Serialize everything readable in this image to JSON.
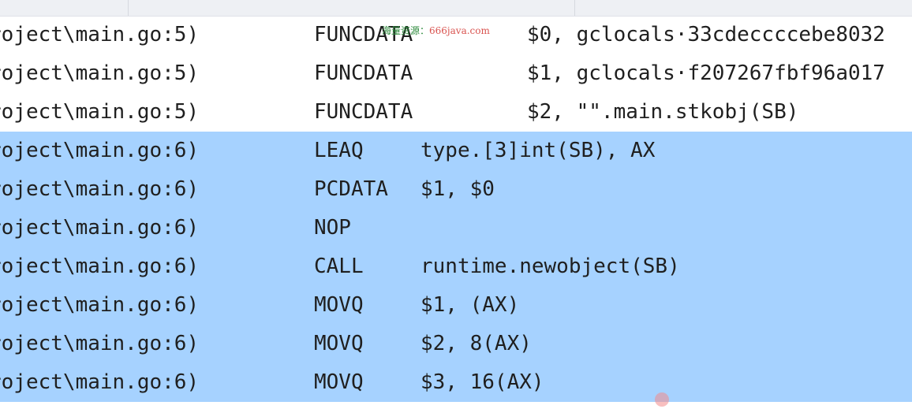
{
  "watermark": {
    "text": "海量资源：",
    "url": "666java.com"
  },
  "rows": [
    {
      "loc": "roject\\main.go:5)",
      "op": "FUNCDATA",
      "args": "$0, gclocals·33cdeccccebe8032",
      "selected": false,
      "argx": 668
    },
    {
      "loc": "roject\\main.go:5)",
      "op": "FUNCDATA",
      "args": "$1, gclocals·f207267fbf96a017",
      "selected": false,
      "argx": 668
    },
    {
      "loc": "roject\\main.go:5)",
      "op": "FUNCDATA",
      "args": "$2, \"\".main.stkobj(SB)",
      "selected": false,
      "argx": 668
    },
    {
      "loc": "roject\\main.go:6)",
      "op": "LEAQ",
      "args": "type.[3]int(SB), AX",
      "selected": true,
      "argx": 533
    },
    {
      "loc": "roject\\main.go:6)",
      "op": "PCDATA",
      "args": "$1, $0",
      "selected": true,
      "argx": 533
    },
    {
      "loc": "roject\\main.go:6)",
      "op": "NOP",
      "args": "",
      "selected": true,
      "argx": 533
    },
    {
      "loc": "roject\\main.go:6)",
      "op": "CALL",
      "args": "runtime.newobject(SB)",
      "selected": true,
      "argx": 533
    },
    {
      "loc": "roject\\main.go:6)",
      "op": "MOVQ",
      "args": "$1, (AX)",
      "selected": true,
      "argx": 533
    },
    {
      "loc": "roject\\main.go:6)",
      "op": "MOVQ",
      "args": "$2, 8(AX)",
      "selected": true,
      "argx": 533
    },
    {
      "loc": "roject\\main.go:6)",
      "op": "MOVQ",
      "args": "$3, 16(AX)",
      "selected": true,
      "argx": 533
    }
  ]
}
